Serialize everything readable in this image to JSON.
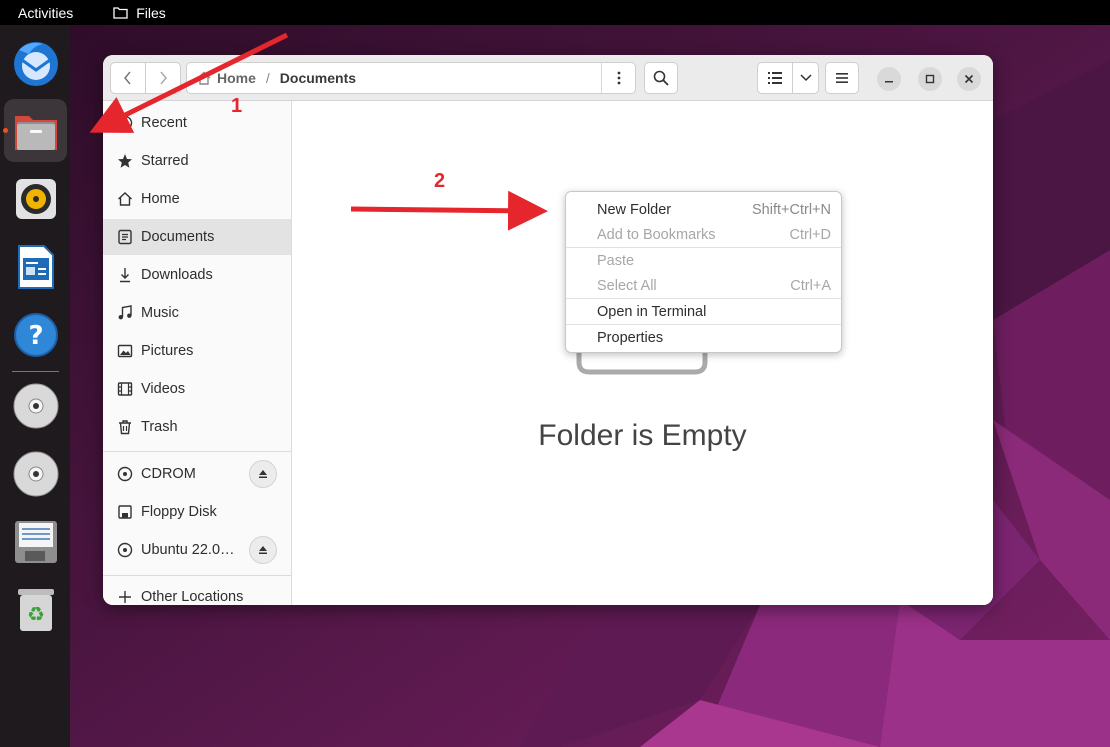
{
  "topbar": {
    "activities": "Activities",
    "app_name": "Files"
  },
  "dock": {
    "items": [
      "thunderbird-icon",
      "files-icon",
      "rhythmbox-icon",
      "writer-icon",
      "help-icon",
      "cdrom-icon",
      "dvd-icon",
      "floppy-icon",
      "trash-icon"
    ]
  },
  "pathbar": {
    "home": "Home",
    "separator": "/",
    "current": "Documents"
  },
  "sidebar": {
    "items": [
      {
        "label": "Recent",
        "icon": "clock-icon"
      },
      {
        "label": "Starred",
        "icon": "star-icon"
      },
      {
        "label": "Home",
        "icon": "home-icon"
      },
      {
        "label": "Documents",
        "icon": "document-icon"
      },
      {
        "label": "Downloads",
        "icon": "download-icon"
      },
      {
        "label": "Music",
        "icon": "music-icon"
      },
      {
        "label": "Pictures",
        "icon": "picture-icon"
      },
      {
        "label": "Videos",
        "icon": "video-icon"
      },
      {
        "label": "Trash",
        "icon": "trash-icon"
      }
    ],
    "devices": [
      {
        "label": "CDROM",
        "icon": "disc-icon"
      },
      {
        "label": "Floppy Disk",
        "icon": "floppy-icon"
      },
      {
        "label": "Ubuntu 22.0…",
        "icon": "disc-icon"
      }
    ],
    "other": "Other Locations"
  },
  "content": {
    "empty_label": "Folder is Empty"
  },
  "context_menu": {
    "items": [
      {
        "label": "New Folder",
        "shortcut": "Shift+Ctrl+N",
        "enabled": true
      },
      {
        "label": "Add to Bookmarks",
        "shortcut": "Ctrl+D",
        "enabled": false
      },
      {
        "label": "Paste",
        "shortcut": "",
        "enabled": false
      },
      {
        "label": "Select All",
        "shortcut": "Ctrl+A",
        "enabled": false
      },
      {
        "label": "Open in Terminal",
        "shortcut": "",
        "enabled": true
      },
      {
        "label": "Properties",
        "shortcut": "",
        "enabled": true
      }
    ]
  },
  "annotations": {
    "step1": "1",
    "step2": "2"
  },
  "colors": {
    "accent": "#e95420",
    "annotation": "#e5262c",
    "wallpaper_dark": "#3a0f35",
    "wallpaper_light": "#9b2a87"
  }
}
